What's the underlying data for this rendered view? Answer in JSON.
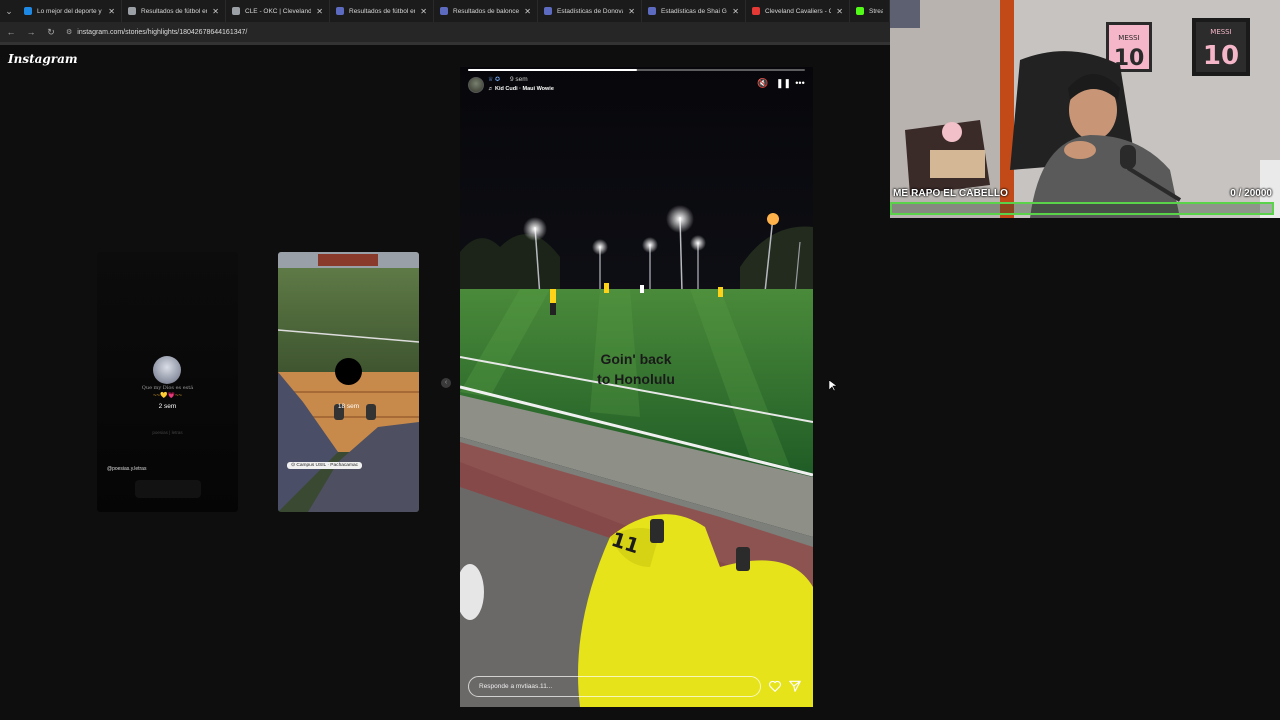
{
  "browser": {
    "tabs": [
      {
        "label": "Lo mejor del deporte y el",
        "favicon_color": "#1e88e5"
      },
      {
        "label": "Resultados de fútbol en v",
        "favicon_color": "#9aa0a6"
      },
      {
        "label": "CLE - OKC | Cleveland Ca",
        "favicon_color": "#9aa0a6"
      },
      {
        "label": "Resultados de fútbol en d",
        "favicon_color": "#5c6bc0"
      },
      {
        "label": "Resultados de baloncesto",
        "favicon_color": "#5c6bc0"
      },
      {
        "label": "Estadísticas de Donovan M",
        "favicon_color": "#5c6bc0"
      },
      {
        "label": "Estadísticas de Shai Gilge",
        "favicon_color": "#5c6bc0"
      },
      {
        "label": "Cleveland Cavaliers - Okla",
        "favicon_color": "#e53935"
      },
      {
        "label": "Stream",
        "favicon_color": "#53fc18"
      }
    ],
    "url": "instagram.com/stories/highlights/18042678644161347/"
  },
  "instagram": {
    "logo": "Instagram",
    "story_left": {
      "quote": "Que my Dios es está",
      "time": "2 sem",
      "faint": "poesias | letras",
      "handle": "@poesias.y.letras"
    },
    "story_mid": {
      "time": "18 sem",
      "location": "Campus USIL · Pachacamac"
    },
    "main_story": {
      "progress": 0.5,
      "time": "9 sem",
      "music": "Kid Cudi · Maui Wowie",
      "caption_line1": "Goin' back",
      "caption_line2": "to Honolulu",
      "reply_placeholder": "Responde a mvtiaas.11..."
    }
  },
  "stream": {
    "goal_label": "ME RAPO EL CABELLO",
    "goal_count": "0   / 20000",
    "goal_progress": 0
  },
  "icons": {
    "mute": "mute-icon",
    "pause": "pause-icon",
    "more": "more-icon",
    "heart": "heart-icon",
    "send": "send-icon"
  }
}
